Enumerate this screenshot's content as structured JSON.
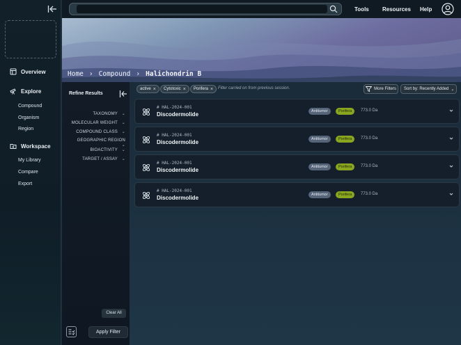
{
  "sidebar": {
    "nav": [
      {
        "label": "Overview",
        "icon": "layout-icon"
      },
      {
        "label": "Explore",
        "icon": "telescope-icon",
        "items": [
          "Compound",
          "Organism",
          "Region"
        ]
      },
      {
        "label": "Workspace",
        "icon": "folder-plus-icon",
        "items": [
          "My Library",
          "Compare",
          "Export"
        ]
      }
    ]
  },
  "topbar": {
    "search_value": "",
    "links": [
      "Tools",
      "Resources",
      "Help"
    ]
  },
  "breadcrumb": [
    "Home",
    "Compound",
    "Halichondrin B"
  ],
  "refine": {
    "title": "Refine Results",
    "facets": [
      "TAXONOMY",
      "MOLECULAR WEIGHT",
      "COMPOUND CLASS",
      "GEOGRAPHIC REGION",
      "BIOACTIVITY",
      "TARGET / ASSAY"
    ],
    "clear_all": "Clear All",
    "apply": "Apply Filter"
  },
  "filters": {
    "chips": [
      "active",
      "Cytotoxic",
      "Porifera"
    ],
    "carry_note": "Filter carried on from previous session.",
    "more_filters": "More Filters",
    "sort_by": "Sort by: Recently Added"
  },
  "results": [
    {
      "id": "# HAL-2024-001",
      "name": "Discodermolide",
      "tags": [
        "Antitumor",
        "Porifera"
      ],
      "mass": "773.0 Da"
    },
    {
      "id": "# HAL-2024-001",
      "name": "Discodermolide",
      "tags": [
        "Antitumor",
        "Porifera"
      ],
      "mass": "773.0 Da"
    },
    {
      "id": "# HAL-2024-001",
      "name": "Discodermolide",
      "tags": [
        "Antitumor",
        "Porifera"
      ],
      "mass": "773.0 Da"
    },
    {
      "id": "# HAL-2024-001",
      "name": "Discodermolide",
      "tags": [
        "Antitumor",
        "Porifera"
      ],
      "mass": "773.0 Da"
    }
  ],
  "colors": {
    "accent_tag": "#8aa51f",
    "neutral_tag": "#56657a"
  }
}
